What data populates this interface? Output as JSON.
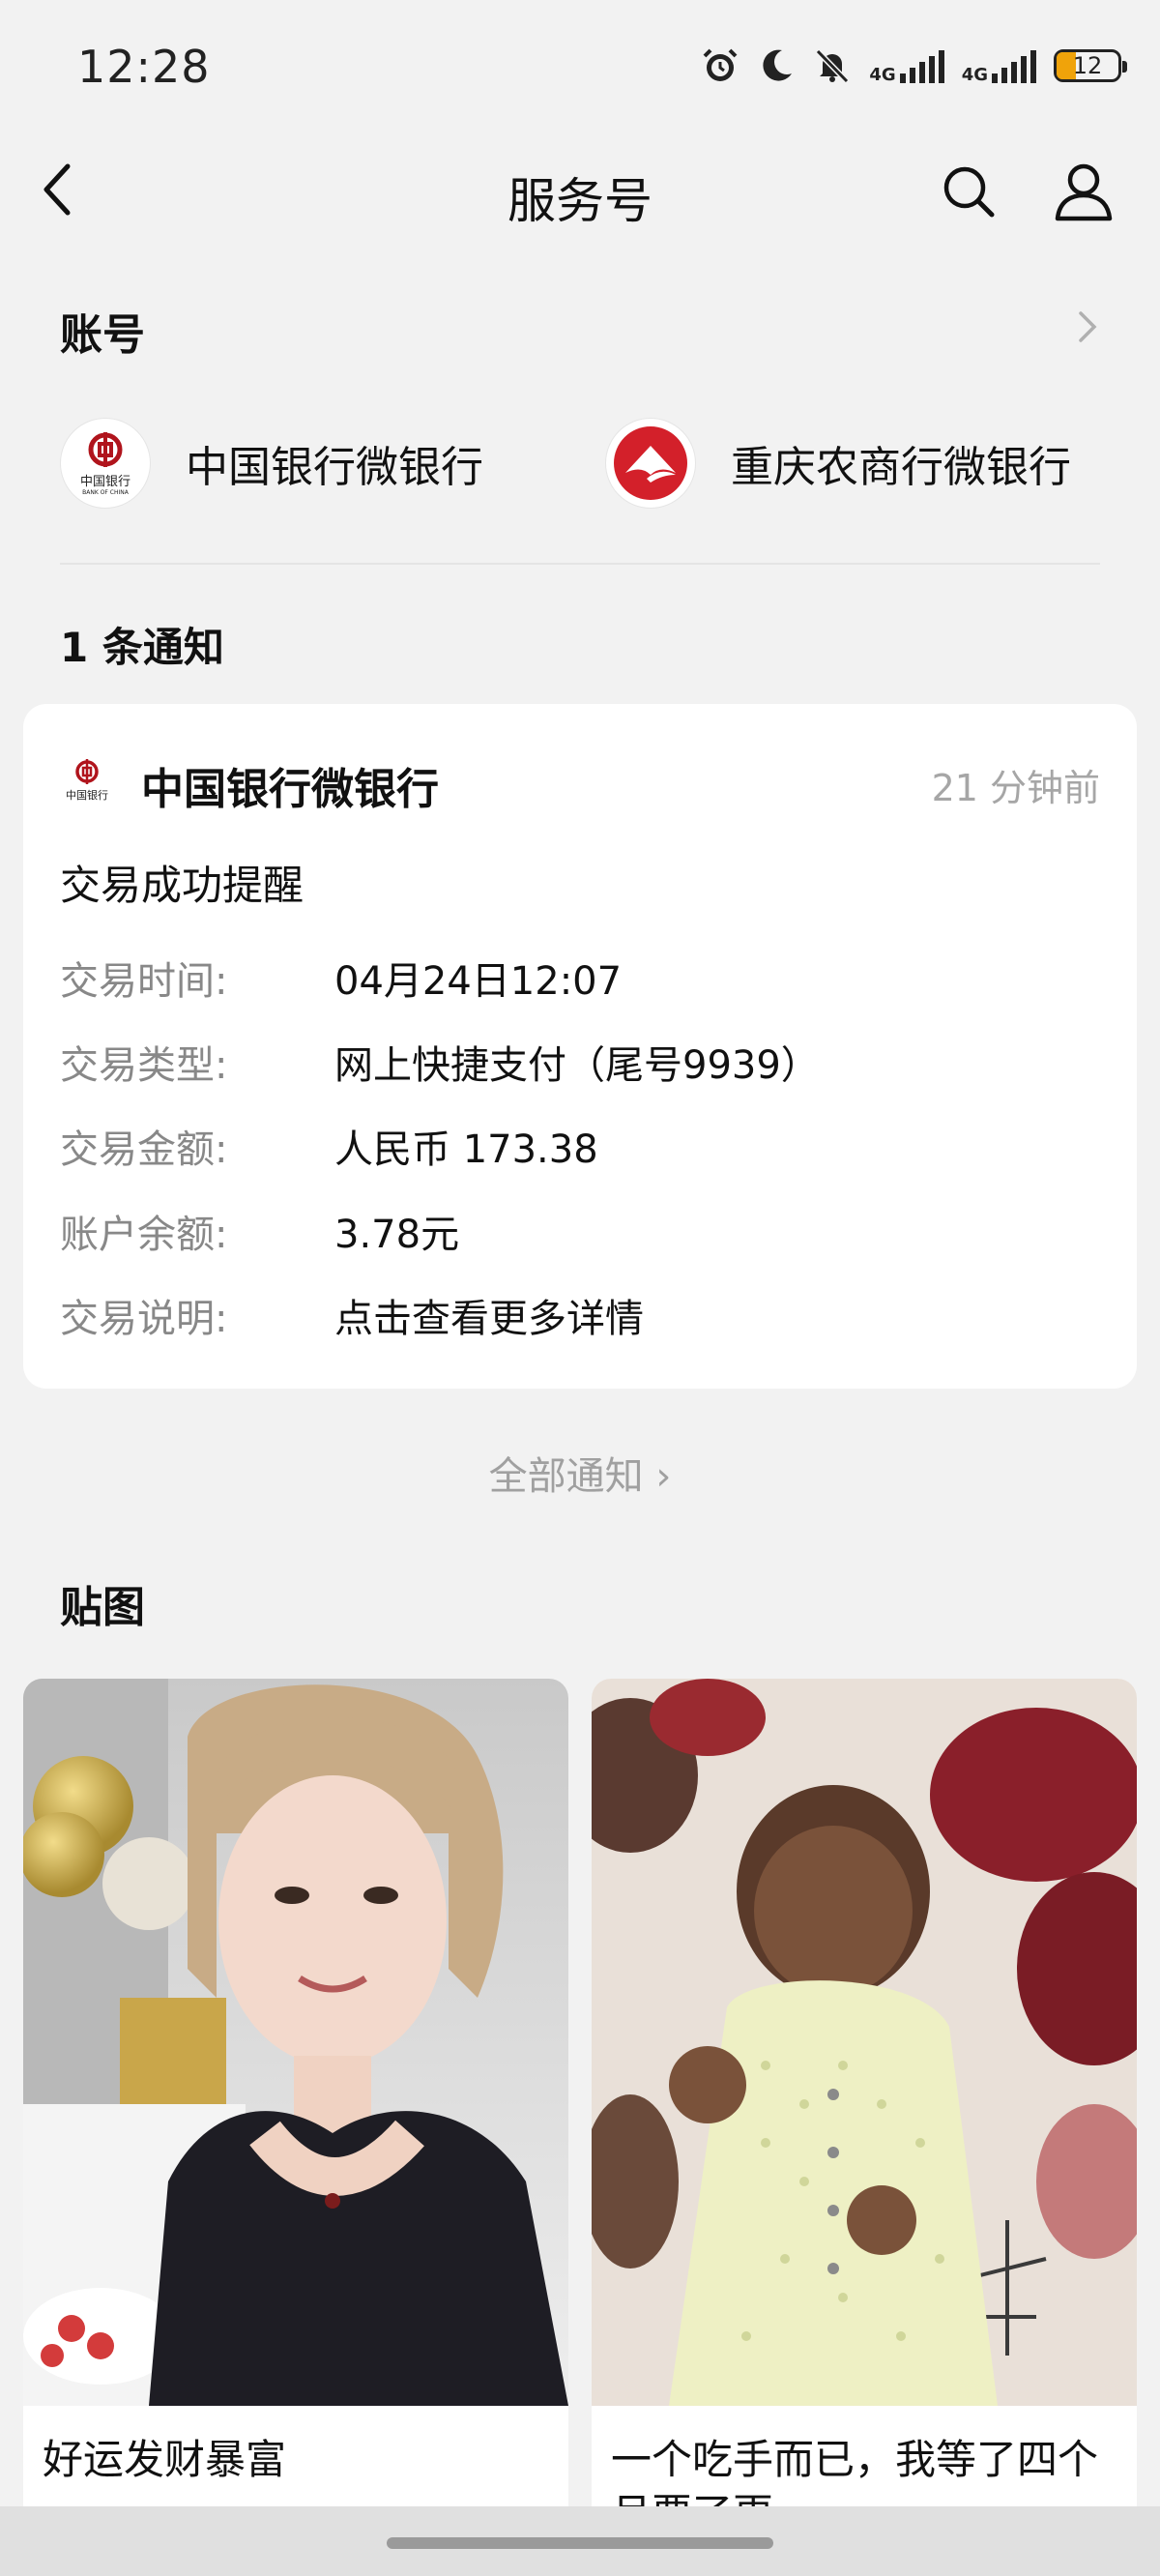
{
  "status": {
    "time": "12:28",
    "battery": "12",
    "network_1": "4G",
    "network_2": "4G"
  },
  "nav": {
    "title": "服务号"
  },
  "accounts": {
    "title": "账号",
    "items": [
      {
        "name": "中国银行微银行",
        "logo_text": "中国银行",
        "logo_sub": "BANK OF CHINA"
      },
      {
        "name": "重庆农商行微银行"
      }
    ]
  },
  "notice": {
    "count_label": "1 条通知",
    "sender": "中国银行微银行",
    "time": "21 分钟前",
    "subject": "交易成功提醒",
    "rows": [
      {
        "label": "交易时间:",
        "value": "04月24日12:07"
      },
      {
        "label": "交易类型:",
        "value": "网上快捷支付（尾号9939）"
      },
      {
        "label": "交易金额:",
        "value": "人民币 173.38"
      },
      {
        "label": "账户余额:",
        "value": "3.78元"
      },
      {
        "label": "交易说明:",
        "value": "点击查看更多详情"
      }
    ],
    "all_label": "全部通知 ›"
  },
  "posts": {
    "title": "贴图",
    "items": [
      {
        "caption": "好运发财暴富"
      },
      {
        "caption": "一个吃手而已，我等了四个月要了更"
      }
    ]
  },
  "colors": {
    "accent_red": "#d3202a",
    "gold": "#c9a64a",
    "background": "#f2f2f2"
  }
}
